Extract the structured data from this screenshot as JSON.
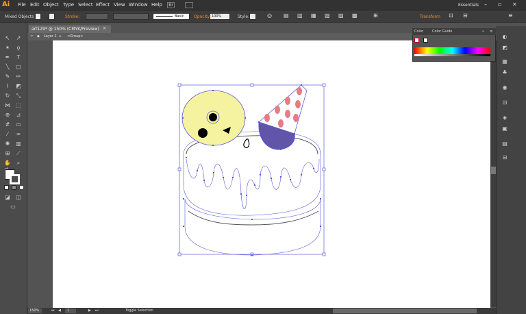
{
  "app": {
    "logo": "Ai"
  },
  "menu": [
    "File",
    "Edit",
    "Object",
    "Type",
    "Select",
    "Effect",
    "View",
    "Window",
    "Help"
  ],
  "workspace": "Essentials",
  "control_bar": {
    "selection": "Mixed Objects",
    "stroke_label": "Stroke:",
    "brush": "Basic",
    "opacity_label": "Opacity:",
    "opacity_value": "100%",
    "style_label": "Style:",
    "transform_label": "Transform"
  },
  "document": {
    "tab_title": "art129* @ 150% (CMYK/Preview)",
    "close": "×",
    "layer": "Layer 1",
    "group": "<Group>"
  },
  "status": {
    "zoom": "150%",
    "page": "1",
    "message": "Toggle Selection"
  },
  "color_panel": {
    "tabs": [
      "Color",
      "Color Guide"
    ]
  },
  "colors": {
    "accent": "#f7a22b",
    "selection_blue": "#5a5adc",
    "yellow_fill": "#f5f2a0",
    "purple_fill": "#6055a8",
    "pink_fill": "#e87c86"
  }
}
